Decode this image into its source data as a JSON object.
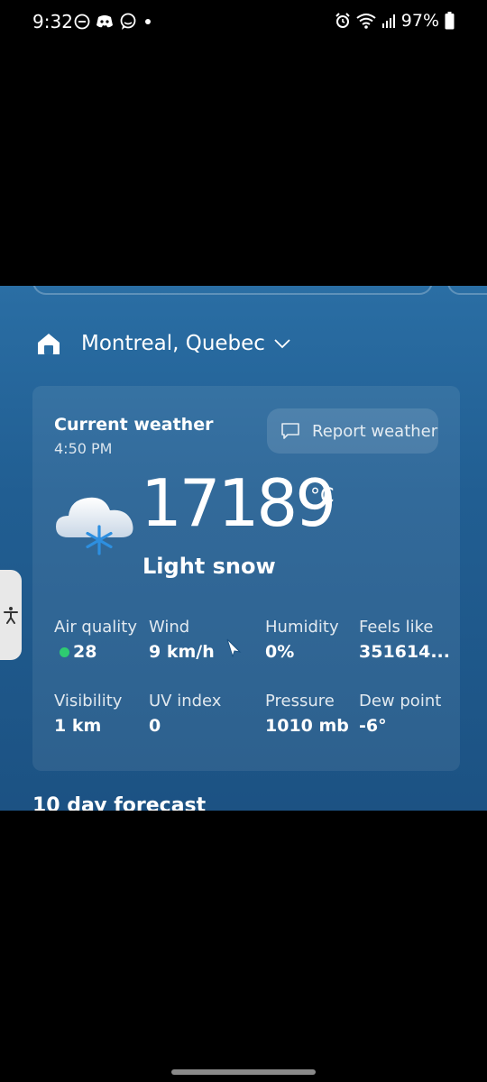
{
  "status_bar": {
    "time": "9:32",
    "battery": "97%",
    "icons": [
      "dnd-icon",
      "discord-icon",
      "chat-icon",
      "dot-icon",
      "alarm-icon",
      "wifi-icon",
      "signal-icon",
      "battery-icon"
    ]
  },
  "location": {
    "name": "Montreal, Quebec"
  },
  "current": {
    "title": "Current weather",
    "time": "4:50 PM",
    "report_label": "Report weather",
    "temperature": "17189",
    "unit": "°C",
    "condition": "Light snow"
  },
  "details": {
    "air_quality": {
      "label": "Air quality",
      "value": "28",
      "color": "#2ecc71"
    },
    "wind": {
      "label": "Wind",
      "value": "9 km/h"
    },
    "humidity": {
      "label": "Humidity",
      "value": "0%"
    },
    "feels_like": {
      "label": "Feels like",
      "value": "351614..."
    },
    "visibility": {
      "label": "Visibility",
      "value": "1 km"
    },
    "uv_index": {
      "label": "UV index",
      "value": "0"
    },
    "pressure": {
      "label": "Pressure",
      "value": "1010 mb"
    },
    "dew_point": {
      "label": "Dew point",
      "value": "-6°"
    }
  },
  "forecast": {
    "title": "10 day forecast"
  },
  "colors": {
    "background_top": "#2a6ea4",
    "background_bottom": "#1c5283",
    "air_quality_good": "#2ecc71"
  }
}
